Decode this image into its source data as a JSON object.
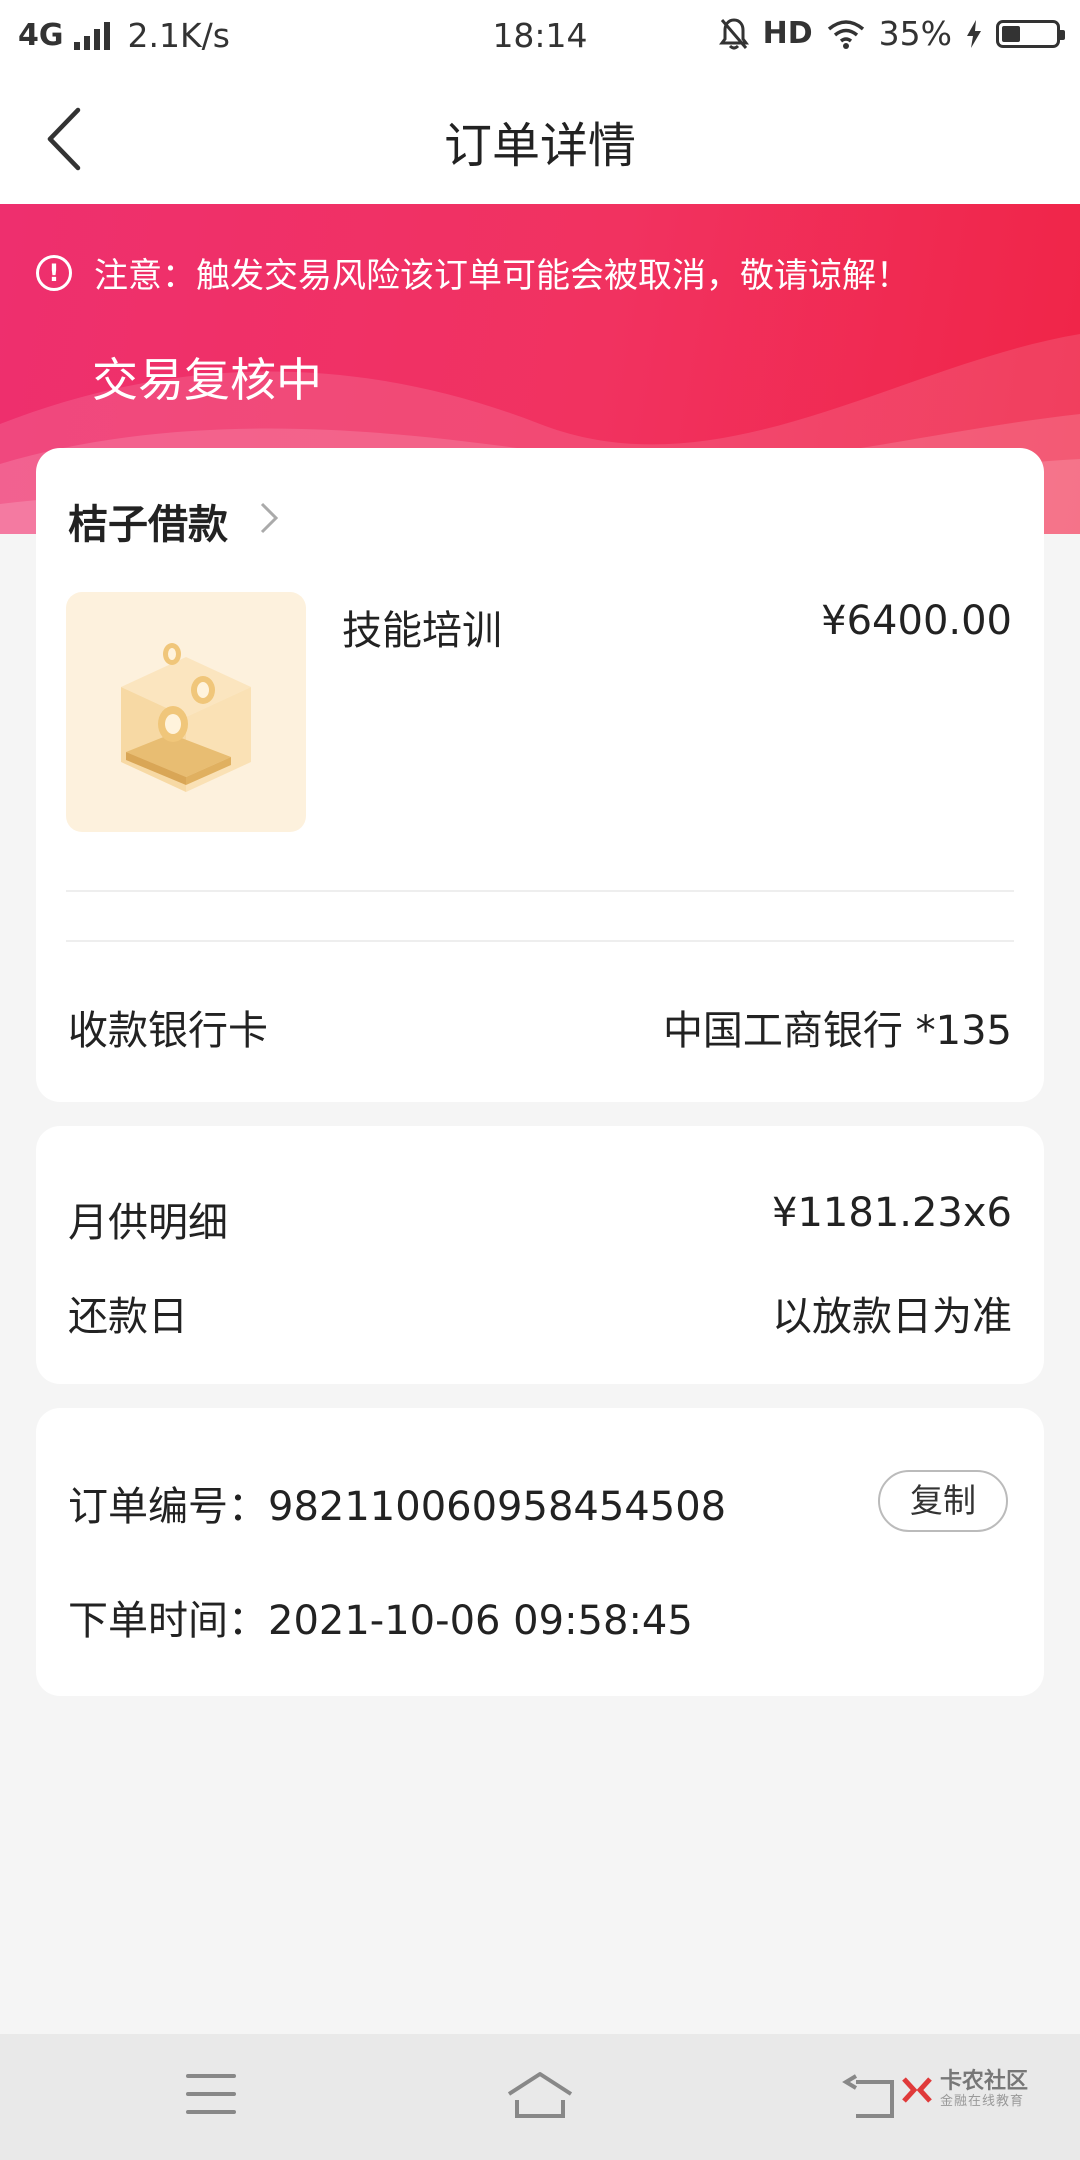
{
  "status_bar": {
    "network": "4G",
    "speed": "2.1K/s",
    "time": "18:14",
    "hd": "HD",
    "battery": "35%",
    "battery_level": 0.35
  },
  "nav": {
    "title": "订单详情"
  },
  "banner": {
    "notice": "注意：触发交易风险该订单可能会被取消，敬请谅解！",
    "status": "交易复核中",
    "gradient_colors": [
      "#ee2f6e",
      "#f02447"
    ]
  },
  "product_card": {
    "merchant": "桔子借款",
    "product_name": "技能培训",
    "price": "¥6400.00",
    "bank_label": "收款银行卡",
    "bank_value": "中国工商银行 *135"
  },
  "repayment_card": {
    "monthly_label": "月供明细",
    "monthly_value": "¥1181.23x6",
    "due_label": "还款日",
    "due_value": "以放款日为准"
  },
  "order_card": {
    "order_no_label": "订单编号：",
    "order_no": "982110060958454508",
    "copy_label": "复制",
    "time_label": "下单时间：",
    "time_value": "2021-10-06 09:58:45"
  },
  "watermark": {
    "title": "卡农社区",
    "subtitle": "金融在线教育"
  }
}
